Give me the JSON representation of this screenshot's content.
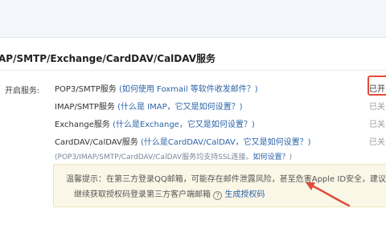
{
  "section": {
    "title": "AP/SMTP/Exchange/CardDAV/CalDAV服务",
    "services_label": "开启服务:"
  },
  "services": [
    {
      "name": "POP3/SMTP服务",
      "hint": "(如何使用 Foxmail 等软件收发邮件？)",
      "status": "已开"
    },
    {
      "name": "IMAP/SMTP服务",
      "hint": "(什么是 IMAP，它又是如何设置？)",
      "status": "已关"
    },
    {
      "name": "Exchange服务",
      "hint": "(什么是Exchange，它又是如何设置？)",
      "status": "已关"
    },
    {
      "name": "CardDAV/CalDAV服务",
      "hint": "(什么是CardDAV/CalDAV，它又是如何设置？)",
      "status": "已关"
    }
  ],
  "note": {
    "text": "(POP3/IMAP/SMTP/CardDAV/CalDAV服务均支持SSL连接。",
    "link": "如何设置？",
    "close": ")"
  },
  "warning": {
    "label": "温馨提示：",
    "line1": "在第三方登录QQ邮箱，可能存在邮件泄露风险，甚至危害Apple ID安全，建议",
    "line2": "继续获取授权码登录第三方客户端邮箱",
    "help_icon": "?",
    "link": "生成授权码"
  },
  "colors": {
    "link": "#2a63a8",
    "highlight_box": "#e04c3c",
    "arrow": "#e04c3c",
    "warning_bg": "#fbf7e6"
  },
  "icons": {
    "help": "question-circle-icon",
    "arrow": "red-arrow-annotation"
  }
}
